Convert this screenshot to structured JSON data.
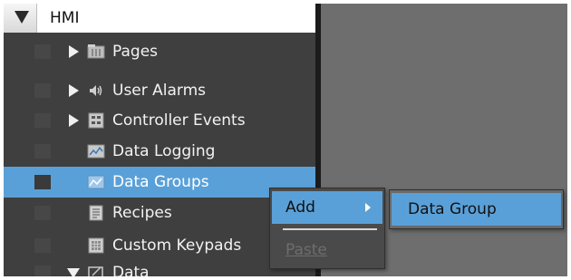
{
  "tree": {
    "root_label": "HMI",
    "items": [
      {
        "label": "Pages",
        "expander": "collapsed",
        "icon": "pages-icon"
      },
      {
        "label": "User Alarms",
        "expander": "collapsed",
        "icon": "speaker-icon"
      },
      {
        "label": "Controller Events",
        "expander": "collapsed",
        "icon": "controller-events-icon"
      },
      {
        "label": "Data Logging",
        "expander": "none",
        "icon": "data-logging-icon"
      },
      {
        "label": "Data Groups",
        "expander": "none",
        "icon": "data-groups-icon",
        "selected": true
      },
      {
        "label": "Recipes",
        "expander": "none",
        "icon": "recipes-icon"
      },
      {
        "label": "Custom Keypads",
        "expander": "none",
        "icon": "keypad-icon"
      },
      {
        "label": "Data",
        "expander": "expanded",
        "icon": "data-icon"
      }
    ]
  },
  "context_menu": {
    "add_label": "Add",
    "paste_label": "Paste",
    "submenu": {
      "items": [
        {
          "label": "Data Group"
        }
      ]
    }
  },
  "colors": {
    "selection": "#5aa0d8",
    "tree_background": "#3f3f3f",
    "right_pane_background": "#6e6e6e"
  }
}
